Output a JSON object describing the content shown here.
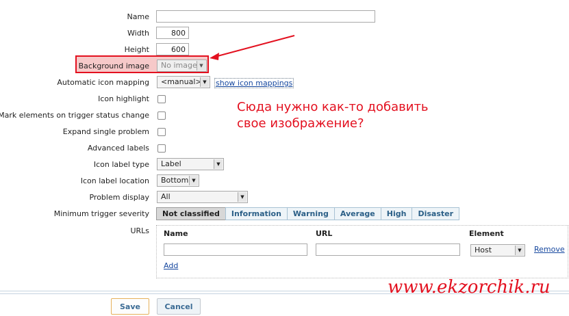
{
  "form": {
    "name": {
      "label": "Name",
      "value": ""
    },
    "width": {
      "label": "Width",
      "value": "800"
    },
    "height": {
      "label": "Height",
      "value": "600"
    },
    "background_image": {
      "label": "Background image",
      "value": "No image"
    },
    "icon_mapping": {
      "label": "Automatic icon mapping",
      "value": "<manual>",
      "link": "show icon mappings"
    },
    "icon_highlight": {
      "label": "Icon highlight",
      "checked": false
    },
    "mark_elements": {
      "label": "Mark elements on trigger status change",
      "checked": false
    },
    "expand_single": {
      "label": "Expand single problem",
      "checked": false
    },
    "advanced_labels": {
      "label": "Advanced labels",
      "checked": false
    },
    "icon_label_type": {
      "label": "Icon label type",
      "value": "Label"
    },
    "icon_label_location": {
      "label": "Icon label location",
      "value": "Bottom"
    },
    "problem_display": {
      "label": "Problem display",
      "value": "All"
    },
    "min_severity": {
      "label": "Minimum trigger severity",
      "options": [
        "Not classified",
        "Information",
        "Warning",
        "Average",
        "High",
        "Disaster"
      ],
      "selected": "Not classified"
    },
    "urls": {
      "label": "URLs",
      "col_name": "Name",
      "col_url": "URL",
      "col_element": "Element",
      "row": {
        "name": "",
        "url": "",
        "element": "Host",
        "remove": "Remove"
      },
      "add": "Add"
    }
  },
  "buttons": {
    "save": "Save",
    "cancel": "Cancel"
  },
  "annotation": {
    "text": "Сюда нужно как-то добавить свое изображение?",
    "watermark": "www.ekzorchik.ru",
    "color": "#e3101f"
  }
}
